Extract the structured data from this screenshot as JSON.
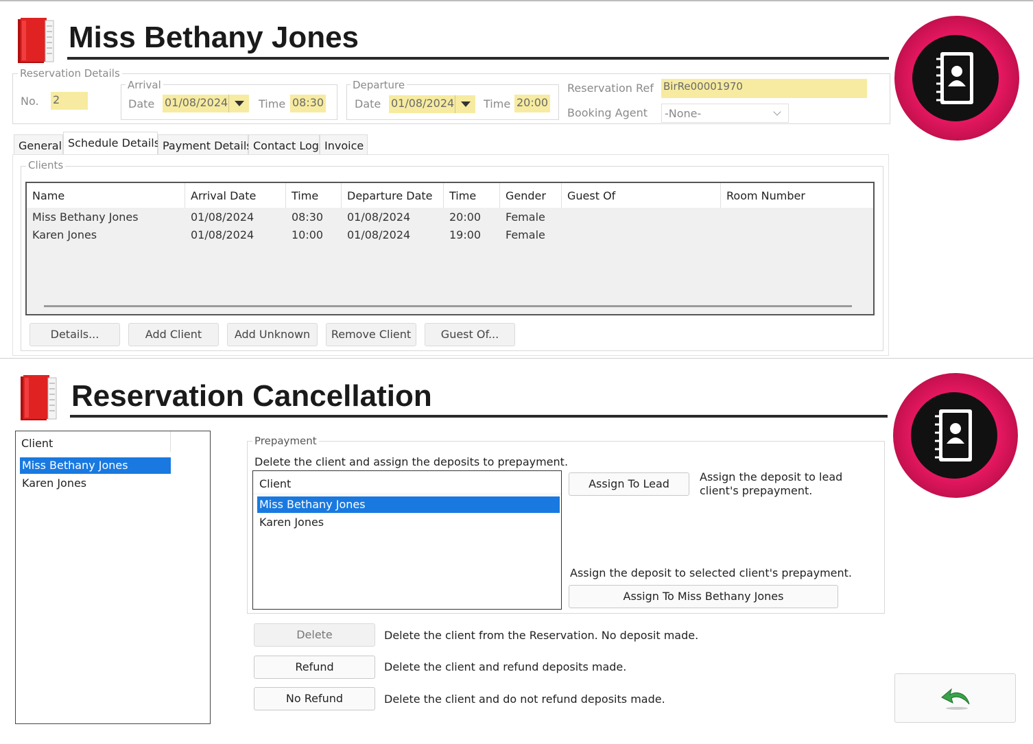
{
  "reservation": {
    "title": "Miss Bethany Jones",
    "details_legend": "Reservation Details",
    "no_label": "No.",
    "no_value": "2",
    "arrival_legend": "Arrival",
    "arrival_date_label": "Date",
    "arrival_date": "01/08/2024",
    "arrival_time_label": "Time",
    "arrival_time": "08:30",
    "departure_legend": "Departure",
    "departure_date_label": "Date",
    "departure_date": "01/08/2024",
    "departure_time_label": "Time",
    "departure_time": "20:00",
    "ref_label": "Reservation Ref",
    "ref_value": "BirRe00001970",
    "agent_label": "Booking Agent",
    "agent_value": "-None-",
    "tabs": [
      "General",
      "Schedule Details",
      "Payment Details",
      "Contact Log",
      "Invoice"
    ],
    "active_tab": "Schedule Details",
    "clients_legend": "Clients",
    "columns": [
      "Name",
      "Arrival Date",
      "Time",
      "Departure Date",
      "Time",
      "Gender",
      "Guest Of",
      "Room Number"
    ],
    "rows": [
      [
        "Miss Bethany Jones",
        "01/08/2024",
        "08:30",
        "01/08/2024",
        "20:00",
        "Female",
        "",
        ""
      ],
      [
        "Karen Jones",
        "01/08/2024",
        "10:00",
        "01/08/2024",
        "19:00",
        "Female",
        "",
        ""
      ]
    ],
    "buttons": {
      "details": "Details...",
      "add_client": "Add Client",
      "add_unknown": "Add Unknown",
      "remove_client": "Remove Client",
      "guest_of": "Guest Of..."
    }
  },
  "cancellation": {
    "title": "Reservation Cancellation",
    "client_list_header": "Client",
    "clients": [
      "Miss Bethany Jones",
      "Karen Jones"
    ],
    "selected_client": "Miss Bethany Jones",
    "prepayment_legend": "Prepayment",
    "prepayment_desc": "Delete the client and assign the deposits to prepayment.",
    "prepay_list_header": "Client",
    "prepay_clients": [
      "Miss Bethany Jones",
      "Karen Jones"
    ],
    "prepay_selected": "Miss Bethany Jones",
    "assign_lead_button": "Assign To Lead",
    "assign_lead_desc_1": "Assign the deposit to lead",
    "assign_lead_desc_2": "client's prepayment.",
    "assign_selected_desc": "Assign the deposit to selected client's prepayment.",
    "assign_selected_button": "Assign To Miss Bethany Jones",
    "delete_button": "Delete",
    "delete_desc": "Delete the client from the Reservation. No deposit made.",
    "refund_button": "Refund",
    "refund_desc": "Delete the client and refund deposits made.",
    "no_refund_button": "No Refund",
    "no_refund_desc": "Delete the client and do not refund deposits made."
  },
  "colors": {
    "accent": "#e0125c",
    "selection": "#1979e0",
    "highlight_field": "#f6eba0"
  },
  "icons": [
    "address-book-icon",
    "contacts-logo-icon",
    "undo-arrow-icon"
  ]
}
